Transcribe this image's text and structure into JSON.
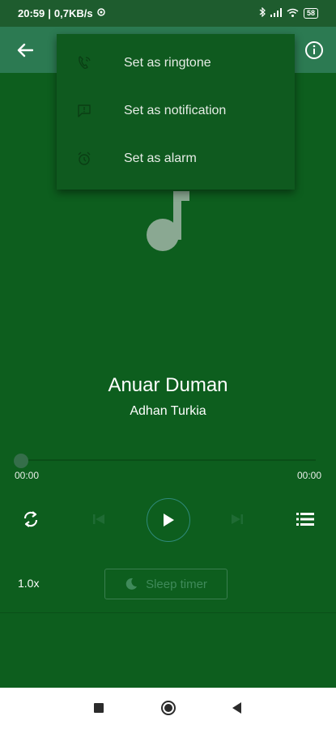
{
  "status_bar": {
    "time": "20:59",
    "speed": "0,7KB/s",
    "battery": "58"
  },
  "menu": {
    "items": [
      {
        "label": "Set as ringtone",
        "icon": "phone-ringtone-icon"
      },
      {
        "label": "Set as notification",
        "icon": "notification-message-icon"
      },
      {
        "label": "Set as alarm",
        "icon": "alarm-clock-icon"
      }
    ]
  },
  "track": {
    "title": "Anuar Duman",
    "artist": "Adhan Turkia"
  },
  "player": {
    "time_current": "00:00",
    "time_total": "00:00",
    "progress": 0,
    "playback_speed": "1.0x",
    "sleep_timer_label": "Sleep timer"
  },
  "colors": {
    "background": "#0d5e1e",
    "app_bar": "#2c7a52",
    "menu_bg": "#0f5a1f",
    "accent_ring": "#2f8a7a"
  }
}
